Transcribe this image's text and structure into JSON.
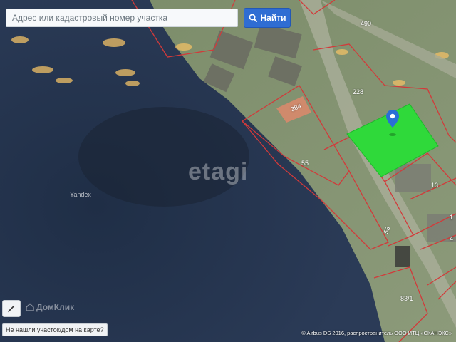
{
  "search": {
    "placeholder": "Адрес или кадастровый номер участка",
    "button_label": "Найти"
  },
  "map": {
    "watermark": "etagi",
    "provider_label": "Yandex",
    "parcel_labels": [
      "490",
      "228",
      "384",
      "55",
      "13",
      "55",
      "83/1",
      "1",
      "4"
    ],
    "selected_parcel_color": "#2fd93a",
    "parcel_border_color": "#d23a3a",
    "pin_color": "#2a6fd6"
  },
  "controls": {
    "brand_label": "ДомКлик",
    "not_found_label": "Не нашли участок/дом на карте?"
  },
  "attribution": "© Airbus DS 2016, распространитель ООО ИТЦ «СКАНЭКС»"
}
